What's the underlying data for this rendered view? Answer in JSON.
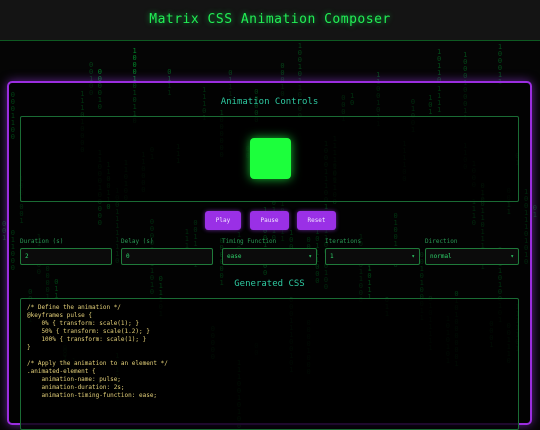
{
  "app": {
    "title": "Matrix CSS Animation Composer"
  },
  "controls_section": {
    "title": "Animation Controls"
  },
  "buttons": {
    "play": "Play",
    "pause": "Pause",
    "reset": "Reset"
  },
  "fields": {
    "duration": {
      "label": "Duration (s)",
      "value": "2"
    },
    "delay": {
      "label": "Delay (s)",
      "value": "0"
    },
    "timing": {
      "label": "Timing Function",
      "value": "ease"
    },
    "iterations": {
      "label": "Iterations",
      "value": "1"
    },
    "direction": {
      "label": "Direction",
      "value": "normal"
    }
  },
  "css_section": {
    "title": "Generated CSS",
    "code": "/* Define the animation */\n@keyframes pulse {\n    0% { transform: scale(1); }\n    50% { transform: scale(1.2); }\n    100% { transform: scale(1); }\n}\n\n/* Apply the animation to an element */\n.animated-element {\n    animation-name: pulse;\n    animation-duration: 2s;\n    animation-timing-function: ease;"
  },
  "colors": {
    "accent_purple": "#9a30e6",
    "matrix_green": "#22dd44",
    "box_green": "#1cff3c",
    "code_text": "#e6d27a"
  },
  "icons": {
    "select_caret": "chevron-down-icon"
  }
}
